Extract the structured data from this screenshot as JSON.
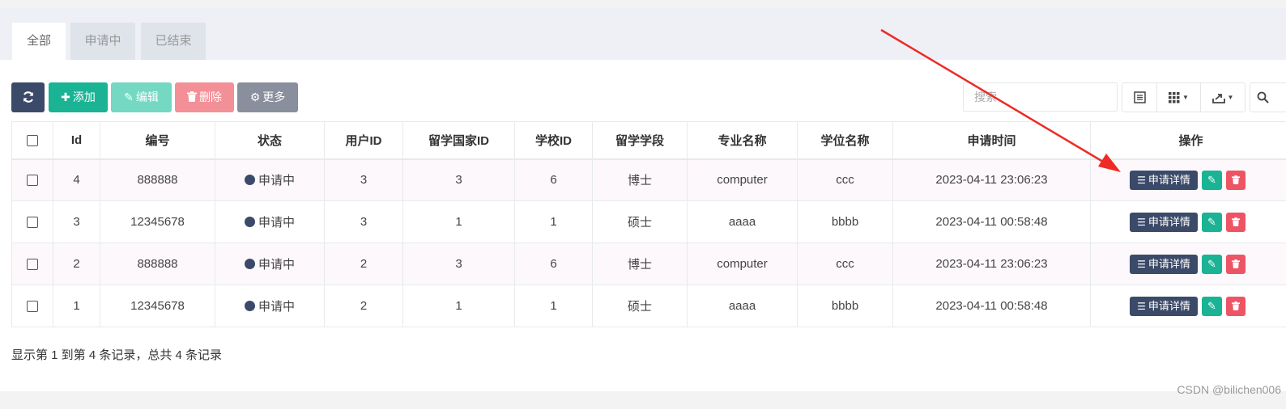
{
  "tabs": [
    {
      "label": "全部",
      "active": true
    },
    {
      "label": "申请中",
      "active": false
    },
    {
      "label": "已结束",
      "active": false
    }
  ],
  "toolbar": {
    "refresh_icon": "refresh-icon",
    "add_label": "添加",
    "edit_label": "编辑",
    "delete_label": "删除",
    "more_label": "更多",
    "colors": {
      "dark": "#3b4a68",
      "green": "#1ab394",
      "green_light": "#74d8c3",
      "red_light": "#f38f97",
      "gray": "#8a8f9e"
    }
  },
  "search": {
    "placeholder": "搜索",
    "value": ""
  },
  "table": {
    "headers": [
      "Id",
      "编号",
      "状态",
      "用户ID",
      "留学国家ID",
      "学校ID",
      "留学学段",
      "专业名称",
      "学位名称",
      "申请时间",
      "操作"
    ],
    "rows": [
      {
        "id": "4",
        "code": "888888",
        "status": "申请中",
        "user_id": "3",
        "country_id": "3",
        "school_id": "6",
        "stage": "博士",
        "major": "computer",
        "degree": "ccc",
        "time": "2023-04-11 23:06:23"
      },
      {
        "id": "3",
        "code": "12345678",
        "status": "申请中",
        "user_id": "3",
        "country_id": "1",
        "school_id": "1",
        "stage": "硕士",
        "major": "aaaa",
        "degree": "bbbb",
        "time": "2023-04-11 00:58:48"
      },
      {
        "id": "2",
        "code": "888888",
        "status": "申请中",
        "user_id": "2",
        "country_id": "3",
        "school_id": "6",
        "stage": "博士",
        "major": "computer",
        "degree": "ccc",
        "time": "2023-04-11 23:06:23"
      },
      {
        "id": "1",
        "code": "12345678",
        "status": "申请中",
        "user_id": "2",
        "country_id": "1",
        "school_id": "1",
        "stage": "硕士",
        "major": "aaaa",
        "degree": "bbbb",
        "time": "2023-04-11 00:58:48"
      }
    ],
    "detail_label": "申请详情"
  },
  "footer": {
    "summary": "显示第 1 到第 4 条记录，总共 4 条记录"
  },
  "watermark": "CSDN @bilichen006"
}
